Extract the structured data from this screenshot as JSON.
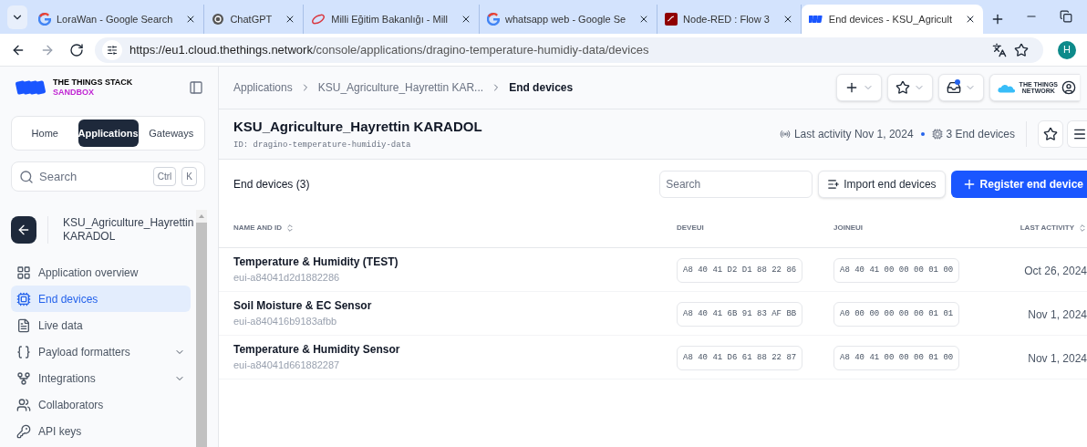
{
  "browser": {
    "tabs": [
      {
        "title": "LoraWan - Google Search",
        "kind": "google",
        "selected": false
      },
      {
        "title": "ChatGPT",
        "kind": "chatgpt",
        "selected": false
      },
      {
        "title": "Milli Eğitim Bakanlığı - Mill",
        "kind": "meb",
        "selected": false
      },
      {
        "title": "whatsapp web - Google Se",
        "kind": "google",
        "selected": false
      },
      {
        "title": "Node-RED : Flow 3",
        "kind": "nodered",
        "selected": false
      },
      {
        "title": "End devices - KSU_Agricult",
        "kind": "ttn",
        "selected": true
      }
    ],
    "url_host": "https://eu1.cloud.thethings.network",
    "url_path": "/console/applications/dragino-temperature-humidiy-data/devices",
    "profile": "H"
  },
  "sidebar": {
    "logo_line1": "THE THINGS STACK",
    "logo_line2": "SANDBOX",
    "switcher": [
      {
        "label": "Home",
        "selected": false
      },
      {
        "label": "Applications",
        "selected": true
      },
      {
        "label": "Gateways",
        "selected": false
      }
    ],
    "search": {
      "placeholder": "Search",
      "keys": [
        "Ctrl",
        "K"
      ]
    },
    "app_name": "KSU_Agriculture_Hayrettin KARADOL",
    "items": [
      {
        "label": "Application overview",
        "kind": "overview",
        "selected": false,
        "submenu": false
      },
      {
        "label": "End devices",
        "kind": "devices",
        "selected": true,
        "submenu": false
      },
      {
        "label": "Live data",
        "kind": "live",
        "selected": false,
        "submenu": false
      },
      {
        "label": "Payload formatters",
        "kind": "formatters",
        "selected": false,
        "submenu": true
      },
      {
        "label": "Integrations",
        "kind": "integrations",
        "selected": false,
        "submenu": true
      },
      {
        "label": "Collaborators",
        "kind": "collaborators",
        "selected": false,
        "submenu": false
      },
      {
        "label": "API keys",
        "kind": "keys",
        "selected": false,
        "submenu": false
      }
    ]
  },
  "breadcrumbs": [
    "Applications",
    "KSU_Agriculture_Hayrettin KAR...",
    "End devices"
  ],
  "topbar": {
    "brand_line1": "THE THINGS",
    "brand_line2": "NETWORK",
    "notification": true
  },
  "header": {
    "title": "KSU_Agriculture_Hayrettin KARADOL",
    "id_label": "ID:",
    "id": "dragino-temperature-humidiy-data",
    "last_activity": "Last activity Nov 1, 2024",
    "device_count": "3 End devices"
  },
  "toolbar": {
    "title": "End devices (3)",
    "search": {
      "placeholder": "Search"
    },
    "import": "Import end devices",
    "register": "Register end device"
  },
  "table": {
    "columns": [
      {
        "label": "NAME AND ID",
        "sortable": true
      },
      {
        "label": "DEVEUI",
        "sortable": false
      },
      {
        "label": "JOINEUI",
        "sortable": false
      },
      {
        "label": "LAST ACTIVITY",
        "sortable": true
      }
    ],
    "rows": [
      {
        "name": "Temperature & Humidity (TEST)",
        "id": "eui-a84041d2d1882286",
        "deveui": "A8 40 41 D2 D1 88 22 86",
        "joineui": "A8 40 41 00 00 00 01 00",
        "last_activity": "Oct 26, 2024"
      },
      {
        "name": "Soil Moisture & EC Sensor",
        "id": "eui-a840416b9183afbb",
        "deveui": "A8 40 41 6B 91 83 AF BB",
        "joineui": "A0 00 00 00 00 00 01 01",
        "last_activity": "Nov 1, 2024"
      },
      {
        "name": "Temperature & Humidity Sensor",
        "id": "eui-a84041d661882287",
        "deveui": "A8 40 41 D6 61 88 22 87",
        "joineui": "A8 40 41 00 00 00 01 00",
        "last_activity": "Nov 1, 2024"
      }
    ]
  }
}
